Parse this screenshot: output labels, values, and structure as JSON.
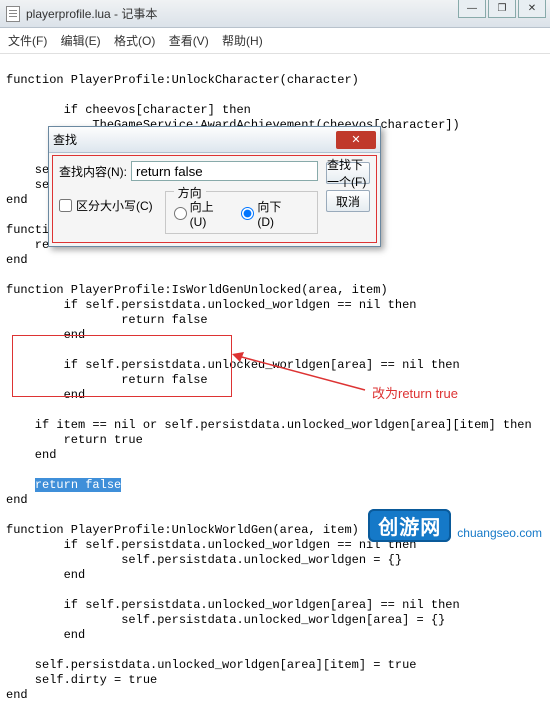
{
  "window": {
    "title": "playerprofile.lua - 记事本",
    "min": "—",
    "max": "❐",
    "close": "✕"
  },
  "menu": {
    "file": "文件(F)",
    "edit": "编辑(E)",
    "format": "格式(O)",
    "view": "查看(V)",
    "help": "帮助(H)"
  },
  "code_top": "\nfunction PlayerProfile:UnlockCharacter(character)\n\n        if cheevos[character] then\n            TheGameService:AwardAchievement(cheevos[character])\n        end\n\n    se\n    se\nend\n\nfuncti\n    re\nend\n",
  "code_mid": "\nfunction PlayerProfile:IsWorldGenUnlocked(area, item)\n        if self.persistdata.unlocked_worldgen == nil then\n                return false\n        end\n\n        if self.persistdata.unlocked_worldgen[area] == nil then\n                return false\n        end\n\n    if item == nil or self.persistdata.unlocked_worldgen[area][item] then\n        return true\n    end\n\n    ",
  "highlight": "return false",
  "code_after_hl": "\nend\n",
  "code_bottom": "\nfunction PlayerProfile:UnlockWorldGen(area, item)\n        if self.persistdata.unlocked_worldgen == nil then\n                self.persistdata.unlocked_worldgen = {}\n        end\n\n        if self.persistdata.unlocked_worldgen[area] == nil then\n                self.persistdata.unlocked_worldgen[area] = {}\n        end\n\n    self.persistdata.unlocked_worldgen[area][item] = true\n    self.dirty = true\nend",
  "dialog": {
    "title": "查找",
    "label_content": "查找内容(N):",
    "value": "return false",
    "group": "方向",
    "radio_up": "向上(U)",
    "radio_down": "向下(D)",
    "checkbox": "区分大小写(C)",
    "btn_next": "查找下一个(F)",
    "btn_cancel": "取消"
  },
  "annotation": "改为return true",
  "logo": {
    "text": "创游网",
    "sub": "chuangseo.com"
  }
}
